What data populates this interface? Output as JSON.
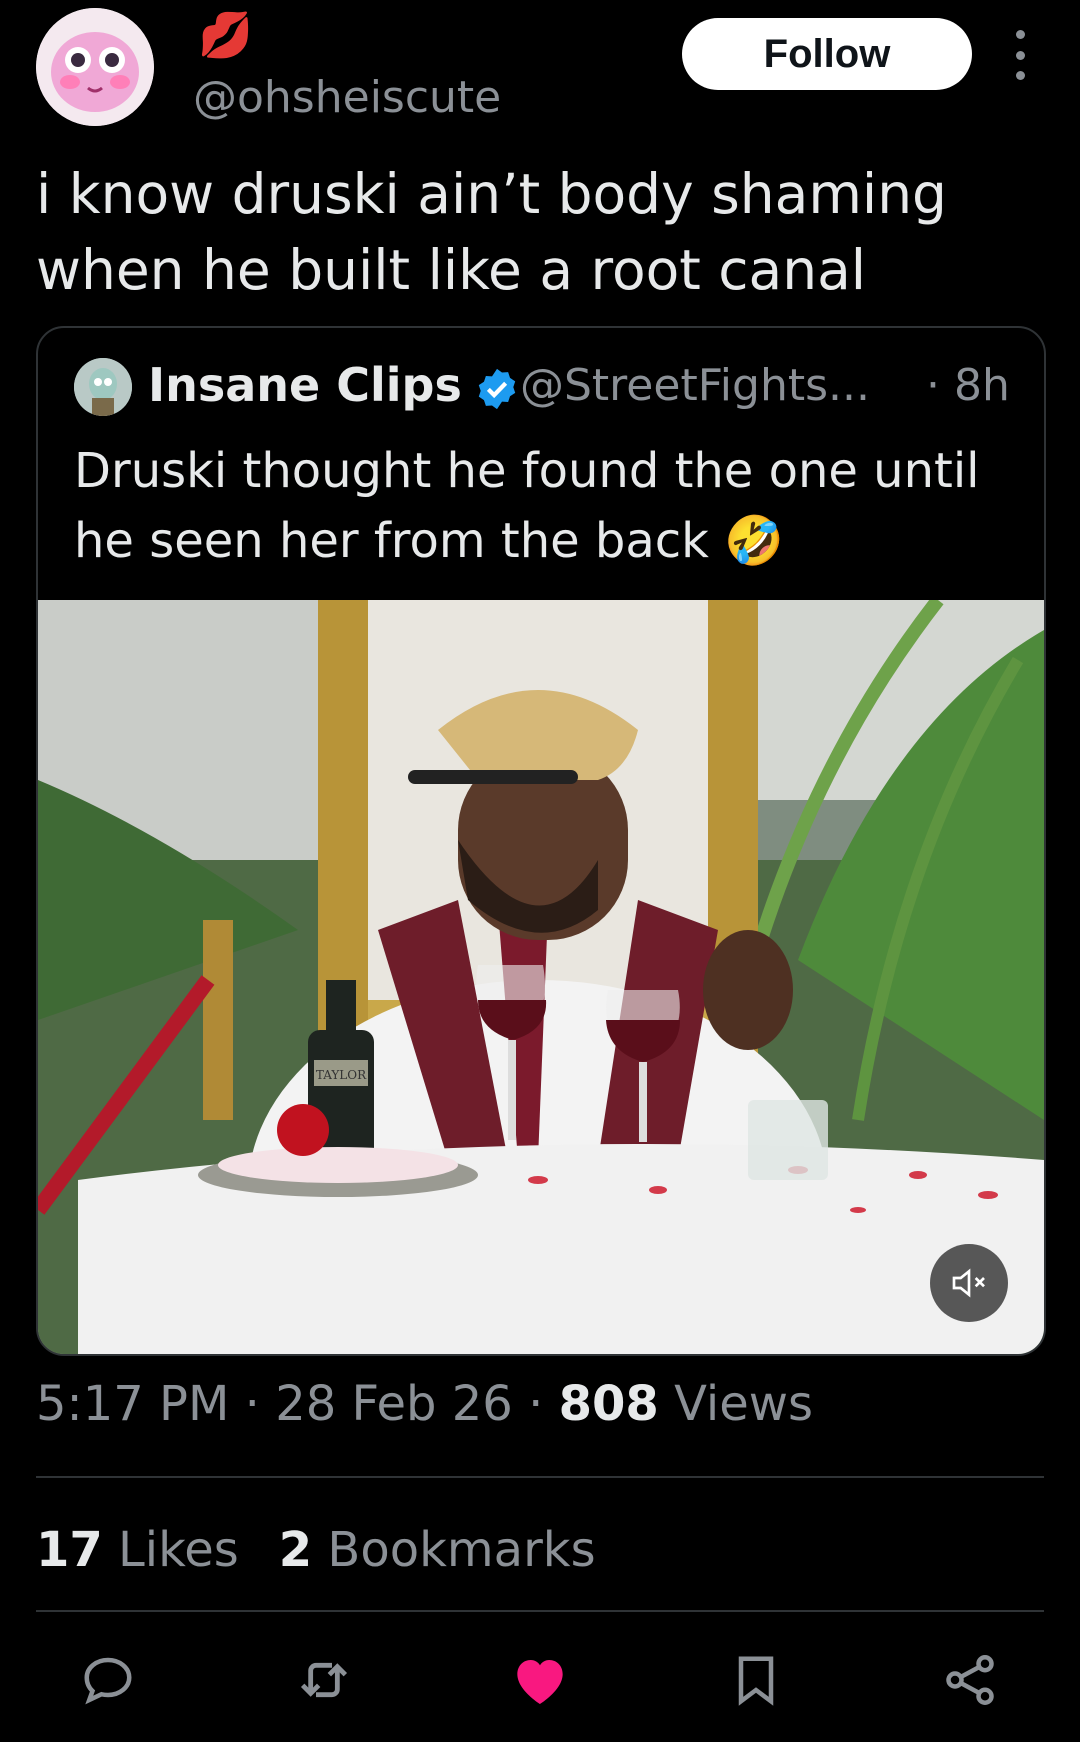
{
  "post": {
    "author_emoji": "💋",
    "handle": "@ohsheiscute",
    "follow_label": "Follow",
    "text_line1": "i know druski ain’t body shaming",
    "text_line2": "when he built like a root canal"
  },
  "quote": {
    "name": "Insane Clips",
    "handle": "@StreetFights...",
    "time": "· 8h",
    "text_line1": "Druski thought he found the one until",
    "text_line2": "he seen her from the back 🤣",
    "bottle_label": "TAYLOR"
  },
  "meta": {
    "time": "5:17 PM",
    "sep1": " · ",
    "date": "28 Feb 26",
    "sep2": " · ",
    "views_count": "808",
    "views_label": " Views"
  },
  "stats": {
    "likes_count": "17",
    "likes_label": " Likes",
    "bookmarks_count": "2",
    "bookmarks_label": " Bookmarks"
  },
  "colors": {
    "background": "#000000",
    "text": "#e7e9ea",
    "muted": "#8b9096",
    "like_active": "#f91880",
    "verified": "#1d9bf0"
  },
  "icons": [
    "more-icon",
    "verified-icon",
    "mute-icon",
    "reply-icon",
    "repost-icon",
    "like-icon",
    "bookmark-icon",
    "share-icon"
  ]
}
